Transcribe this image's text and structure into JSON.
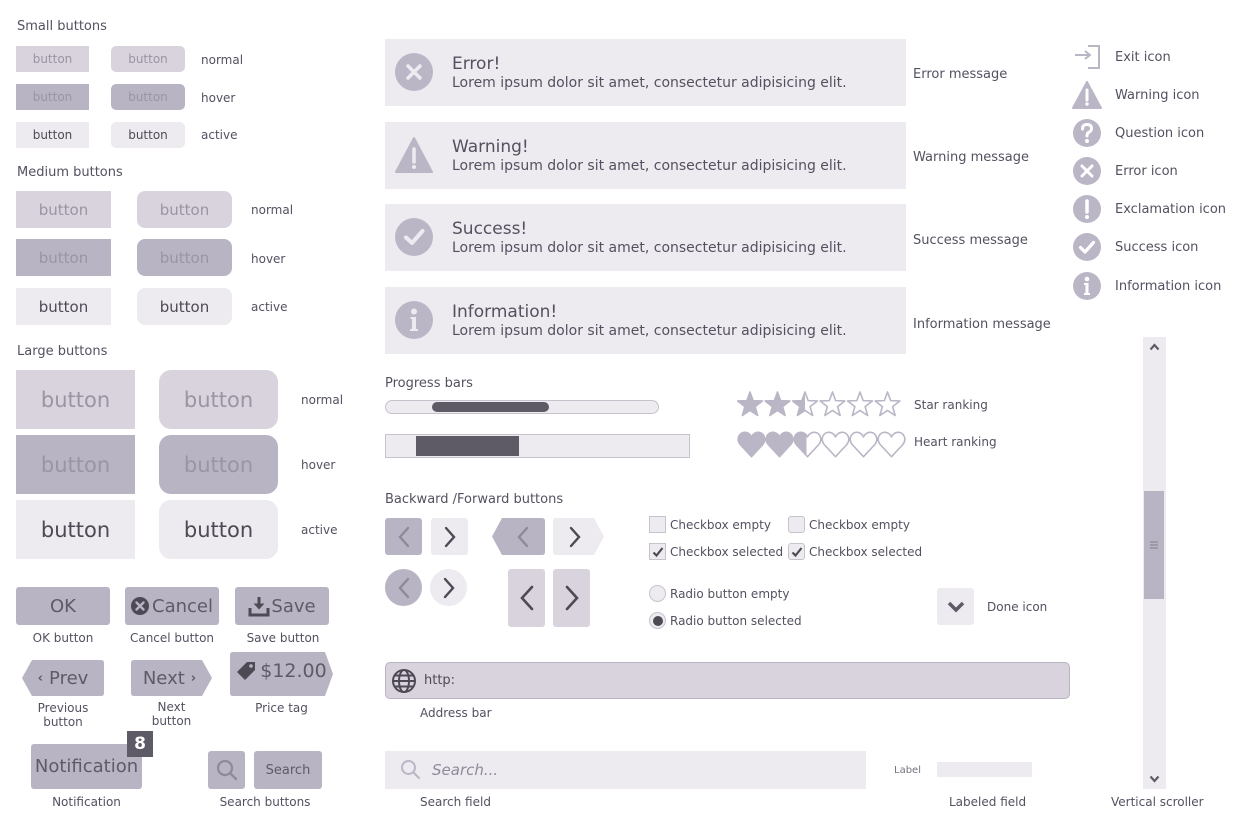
{
  "colors": {
    "normal": "#d9d3de",
    "hover": "#b9b4c3",
    "active": "#edebf0",
    "icon": "#bbb6c6",
    "dark": "#5e5b66",
    "text": "#555060"
  },
  "small_buttons": {
    "heading": "Small buttons",
    "button_label": "button",
    "states": [
      "normal",
      "hover",
      "active"
    ]
  },
  "medium_buttons": {
    "heading": "Medium buttons",
    "button_label": "button",
    "states": [
      "normal",
      "hover",
      "active"
    ]
  },
  "large_buttons": {
    "heading": "Large buttons",
    "button_label": "button",
    "states": [
      "normal",
      "hover",
      "active"
    ]
  },
  "action_buttons": {
    "ok": {
      "label": "OK",
      "caption": "OK button"
    },
    "cancel": {
      "label": "Cancel",
      "caption": "Cancel button",
      "icon": "close-circle-icon"
    },
    "save": {
      "label": "Save",
      "caption": "Save button",
      "icon": "download-icon"
    },
    "prev": {
      "label": "Prev",
      "caption_line1": "Previous",
      "caption_line2": "button",
      "icon": "chevron-left-icon"
    },
    "next": {
      "label": "Next",
      "caption_line1": "Next",
      "caption_line2": "button",
      "icon": "chevron-right-icon"
    },
    "price_tag": {
      "label": "$12.00",
      "caption": "Price tag",
      "icon": "tag-icon"
    },
    "notification": {
      "label": "Notification",
      "badge": "8",
      "caption": "Notification"
    },
    "search_buttons": {
      "label": "Search",
      "caption": "Search buttons",
      "icon": "search-icon"
    }
  },
  "messages": [
    {
      "type": "error",
      "title": "Error!",
      "body": "Lorem ipsum dolor sit amet, consectetur adipisicing elit.",
      "caption": "Error message",
      "icon": "error-icon"
    },
    {
      "type": "warning",
      "title": "Warning!",
      "body": "Lorem ipsum dolor sit amet, consectetur adipisicing elit.",
      "caption": "Warning message",
      "icon": "warning-icon"
    },
    {
      "type": "success",
      "title": "Success!",
      "body": "Lorem ipsum dolor sit amet, consectetur adipisicing elit.",
      "caption": "Success message",
      "icon": "success-icon"
    },
    {
      "type": "info",
      "title": "Information!",
      "body": "Lorem ipsum dolor sit amet, consectetur adipisicing elit.",
      "caption": "Information message",
      "icon": "information-icon"
    }
  ],
  "icons": [
    {
      "name": "exit-icon",
      "label": "Exit icon"
    },
    {
      "name": "warning-icon",
      "label": "Warning icon"
    },
    {
      "name": "question-icon",
      "label": "Question icon"
    },
    {
      "name": "error-icon",
      "label": "Error icon"
    },
    {
      "name": "exclamation-icon",
      "label": "Exclamation icon"
    },
    {
      "name": "success-icon",
      "label": "Success icon"
    },
    {
      "name": "information-icon",
      "label": "Information icon"
    }
  ],
  "progress": {
    "heading": "Progress bars",
    "bar1": {
      "start": 0.17,
      "end": 0.6
    },
    "bar2": {
      "start": 0.1,
      "end": 0.44
    }
  },
  "rankings": {
    "star": {
      "label": "Star ranking",
      "value": 2.5,
      "max": 6
    },
    "heart": {
      "label": "Heart ranking",
      "value": 2.5,
      "max": 6
    }
  },
  "backforward": {
    "heading": "Backward /Forward buttons"
  },
  "checkboxes": {
    "empty": "Checkbox empty",
    "selected": "Checkbox selected"
  },
  "radios": {
    "empty": "Radio button empty",
    "selected": "Radio button selected"
  },
  "done": {
    "label": "Done icon"
  },
  "address_bar": {
    "value": "http:",
    "caption": "Address bar"
  },
  "search_field": {
    "placeholder": "Search...",
    "caption": "Search field"
  },
  "labeled_field": {
    "label": "Label",
    "value": "",
    "caption": "Labeled field"
  },
  "scroller": {
    "caption": "Vertical scroller",
    "thumb_start": 0.34,
    "thumb_end": 0.58
  }
}
